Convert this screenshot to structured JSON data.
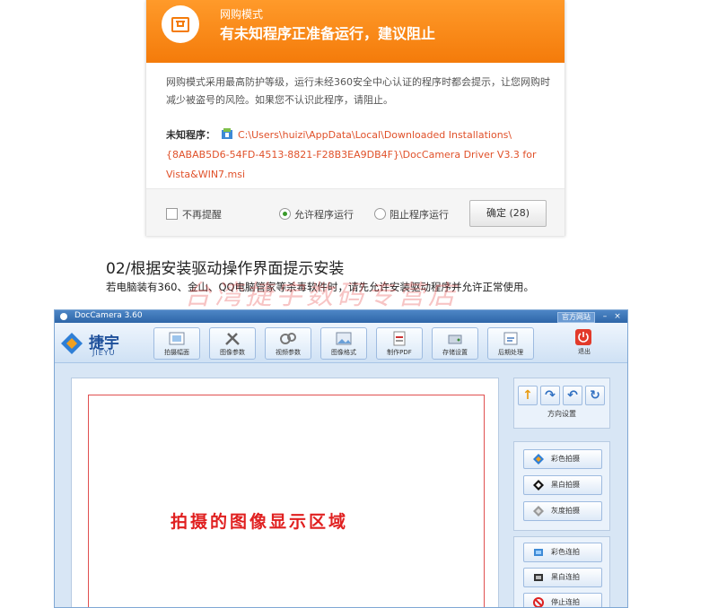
{
  "dialog": {
    "mode_label": "网购模式",
    "headline": "有未知程序正准备运行，建议阻止",
    "description": "网购模式采用最高防护等级，运行未经360安全中心认证的程序时都会提示，让您网购时减少被盗号的风险。如果您不认识此程序，请阻止。",
    "unknown_label": "未知程序：",
    "unknown_path": "C:\\Users\\huizi\\AppData\\Local\\Downloaded Installations\\{8ABAB5D6-54FD-4513-8821-F28B3EA9DB4F}\\DocCamera Driver V3.3 for Vista&WIN7.msi",
    "no_remind_label": "不再提醒",
    "allow_label": "允许程序运行",
    "block_label": "阻止程序运行",
    "selected_option": "allow",
    "confirm_label": "确定 (28)",
    "accent": "#f47b0a"
  },
  "step": {
    "title": "02/根据安装驱动操作界面提示安装",
    "description": "若电脑装有360、金山、QQ电脑管家等杀毒软件时，请先允许安装驱动程序并允许正常使用。",
    "watermark": "台湾捷宇数码专营店"
  },
  "app": {
    "title": "DocCamera 3.60",
    "site_button": "官方网站",
    "minimize_label": "–",
    "close_label": "×",
    "logo_cn": "捷宇",
    "logo_en": "JIEYU",
    "toolbar": [
      {
        "name": "capture-frame",
        "label": "拍摄幅面",
        "icon": "frame-icon"
      },
      {
        "name": "image-params",
        "label": "图像参数",
        "icon": "tools-icon"
      },
      {
        "name": "video-params",
        "label": "视频参数",
        "icon": "video-icon"
      },
      {
        "name": "image-format",
        "label": "图像格式",
        "icon": "picture-icon"
      },
      {
        "name": "make-pdf",
        "label": "制作PDF",
        "icon": "pdf-icon"
      },
      {
        "name": "storage-settings",
        "label": "存储设置",
        "icon": "storage-icon"
      },
      {
        "name": "post-processing",
        "label": "后期处理",
        "icon": "process-icon"
      }
    ],
    "exit_label": "退出",
    "preview_label": "拍摄的图像显示区域",
    "direction_label": "方向设置",
    "capture_buttons": [
      {
        "name": "color-capture",
        "label": "彩色拍摄",
        "icon": "color-diamond-icon"
      },
      {
        "name": "bw-capture",
        "label": "黑白拍摄",
        "icon": "black-diamond-icon"
      },
      {
        "name": "gray-capture",
        "label": "灰度拍摄",
        "icon": "gray-diamond-icon"
      }
    ],
    "burst_buttons": [
      {
        "name": "color-burst",
        "label": "彩色连拍",
        "icon": "color-burst-icon"
      },
      {
        "name": "bw-burst",
        "label": "黑白连拍",
        "icon": "bw-burst-icon"
      },
      {
        "name": "stop-burst",
        "label": "停止连拍",
        "icon": "stop-icon"
      }
    ]
  }
}
